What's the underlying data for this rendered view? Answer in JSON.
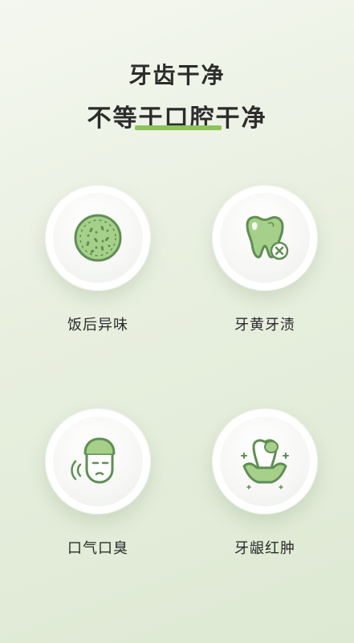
{
  "header": {
    "line1": "牙齿干净",
    "line2": "不等于口腔干净"
  },
  "colors": {
    "accent": "#8dc35a",
    "icon_fill": "#a6d08a",
    "icon_stroke": "#5e8f52"
  },
  "items": [
    {
      "label": "饭后异味",
      "icon": "bacteria-icon"
    },
    {
      "label": "牙黄牙渍",
      "icon": "stained-tooth-icon"
    },
    {
      "label": "口气口臭",
      "icon": "bad-breath-face-icon"
    },
    {
      "label": "牙龈红肿",
      "icon": "swollen-gum-tooth-icon"
    }
  ]
}
